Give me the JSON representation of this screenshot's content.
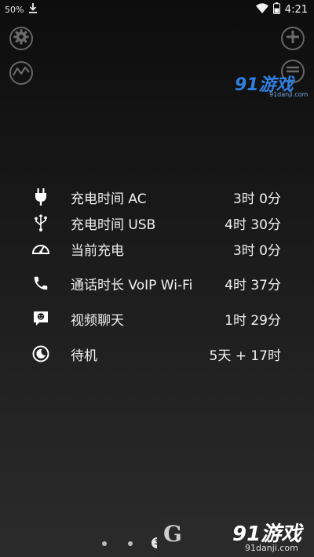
{
  "status_bar": {
    "battery_percent": "50%",
    "time": "4:21"
  },
  "stats": [
    {
      "icon": "plug-icon",
      "label": "充电时间 AC",
      "value": "3时 0分"
    },
    {
      "icon": "usb-icon",
      "label": "充电时间 USB",
      "value": "4时 30分"
    },
    {
      "icon": "gauge-icon",
      "label": "当前充电",
      "value": "3时 0分"
    },
    {
      "icon": "phone-icon",
      "label": "通话时长 VoIP Wi-Fi",
      "value": "4时 37分"
    },
    {
      "icon": "video-chat-icon",
      "label": "视频聊天",
      "value": "1时 29分"
    },
    {
      "icon": "moon-icon",
      "label": "待机",
      "value": "5天 + 17时"
    }
  ],
  "page_indicator": {
    "active_label": "3"
  },
  "watermarks": {
    "top_logo": "91游戏",
    "top_url": "91danji.com",
    "bottom_logo": "91游戏",
    "bottom_url": "91danji.com",
    "bottom_partial": "G"
  },
  "colors": {
    "icon_white": "#ffffff",
    "button_gray": "#666666",
    "logo_blue": "#2f7fe0"
  }
}
